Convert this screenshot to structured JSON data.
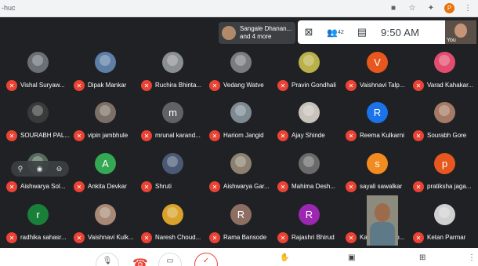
{
  "browser": {
    "url_fragment": "-huc"
  },
  "notification": {
    "line1": "Sangale Dhanan...",
    "line2": "and 4 more"
  },
  "topbar": {
    "people_count": "42",
    "time": "9:50 AM",
    "self_label": "You"
  },
  "participants": [
    {
      "name": "Vishal Suryaw...",
      "avatar": "",
      "color": "#6b6f76"
    },
    {
      "name": "Dipak Mankar",
      "avatar": "",
      "color": "#5d7fa6"
    },
    {
      "name": "Ruchira Bhinta...",
      "avatar": "",
      "color": "#8a8f93"
    },
    {
      "name": "Vedang Watve",
      "avatar": "",
      "color": "#7a7d80"
    },
    {
      "name": "Pravin Gondhali",
      "avatar": "",
      "color": "#b9b04a"
    },
    {
      "name": "Vaishnavi Talp...",
      "avatar": "V",
      "color": "#e8581e"
    },
    {
      "name": "Varad Kahakar...",
      "avatar": "",
      "color": "#e24d6f"
    },
    {
      "name": "SOURABH PAL...",
      "avatar": "",
      "color": "#3a3a3a"
    },
    {
      "name": "vipin jambhule",
      "avatar": "",
      "color": "#7c6f66"
    },
    {
      "name": "mrunal karand...",
      "avatar": "m",
      "color": "#5f6368"
    },
    {
      "name": "Hariom Jangid",
      "avatar": "",
      "color": "#7e8a93"
    },
    {
      "name": "Ajay Shinde",
      "avatar": "",
      "color": "#c7c3bb"
    },
    {
      "name": "Reema Kulkarni",
      "avatar": "R",
      "color": "#1a73e8"
    },
    {
      "name": "Sourabh Gore",
      "avatar": "",
      "color": "#a57a64"
    },
    {
      "name": "Aishwarya Sol...",
      "avatar": "",
      "color": "#566b5b"
    },
    {
      "name": "Ankita Devkar",
      "avatar": "A",
      "color": "#34a853"
    },
    {
      "name": "Shruti",
      "avatar": "",
      "color": "#4b5a74"
    },
    {
      "name": "Aishwarya Gar...",
      "avatar": "",
      "color": "#8c8170"
    },
    {
      "name": "Mahima Desh...",
      "avatar": "",
      "color": "#6a6a6a"
    },
    {
      "name": "sayali sawalkar",
      "avatar": "s",
      "color": "#f28b20"
    },
    {
      "name": "pratiksha jaga...",
      "avatar": "p",
      "color": "#e8581e"
    },
    {
      "name": "radhika sahasr...",
      "avatar": "r",
      "color": "#188038"
    },
    {
      "name": "Vaishnavi Kulk...",
      "avatar": "",
      "color": "#a88976"
    },
    {
      "name": "Naresh Choud...",
      "avatar": "",
      "color": "#d9a22b"
    },
    {
      "name": "Rama Bansode",
      "avatar": "R",
      "color": "#8d6e63"
    },
    {
      "name": "Rajashri Bhirud",
      "avatar": "R",
      "color": "#9c27b0"
    },
    {
      "name": "Kaustubh Rap...",
      "avatar": "",
      "color": "#8d8a7e"
    },
    {
      "name": "Ketan Parmar",
      "avatar": "",
      "color": "#d0d0d0"
    }
  ],
  "icons": {
    "mic_off": "mic-off-icon",
    "present": "present-icon",
    "people": "people-icon",
    "chat": "chat-icon",
    "hand": "raise-hand-icon",
    "captions": "captions-icon",
    "present_now": "present-now-icon",
    "more": "more-icon"
  },
  "colors": {
    "background": "#202124",
    "mic_off": "#ea4335",
    "toolbar": "#ffffff"
  }
}
